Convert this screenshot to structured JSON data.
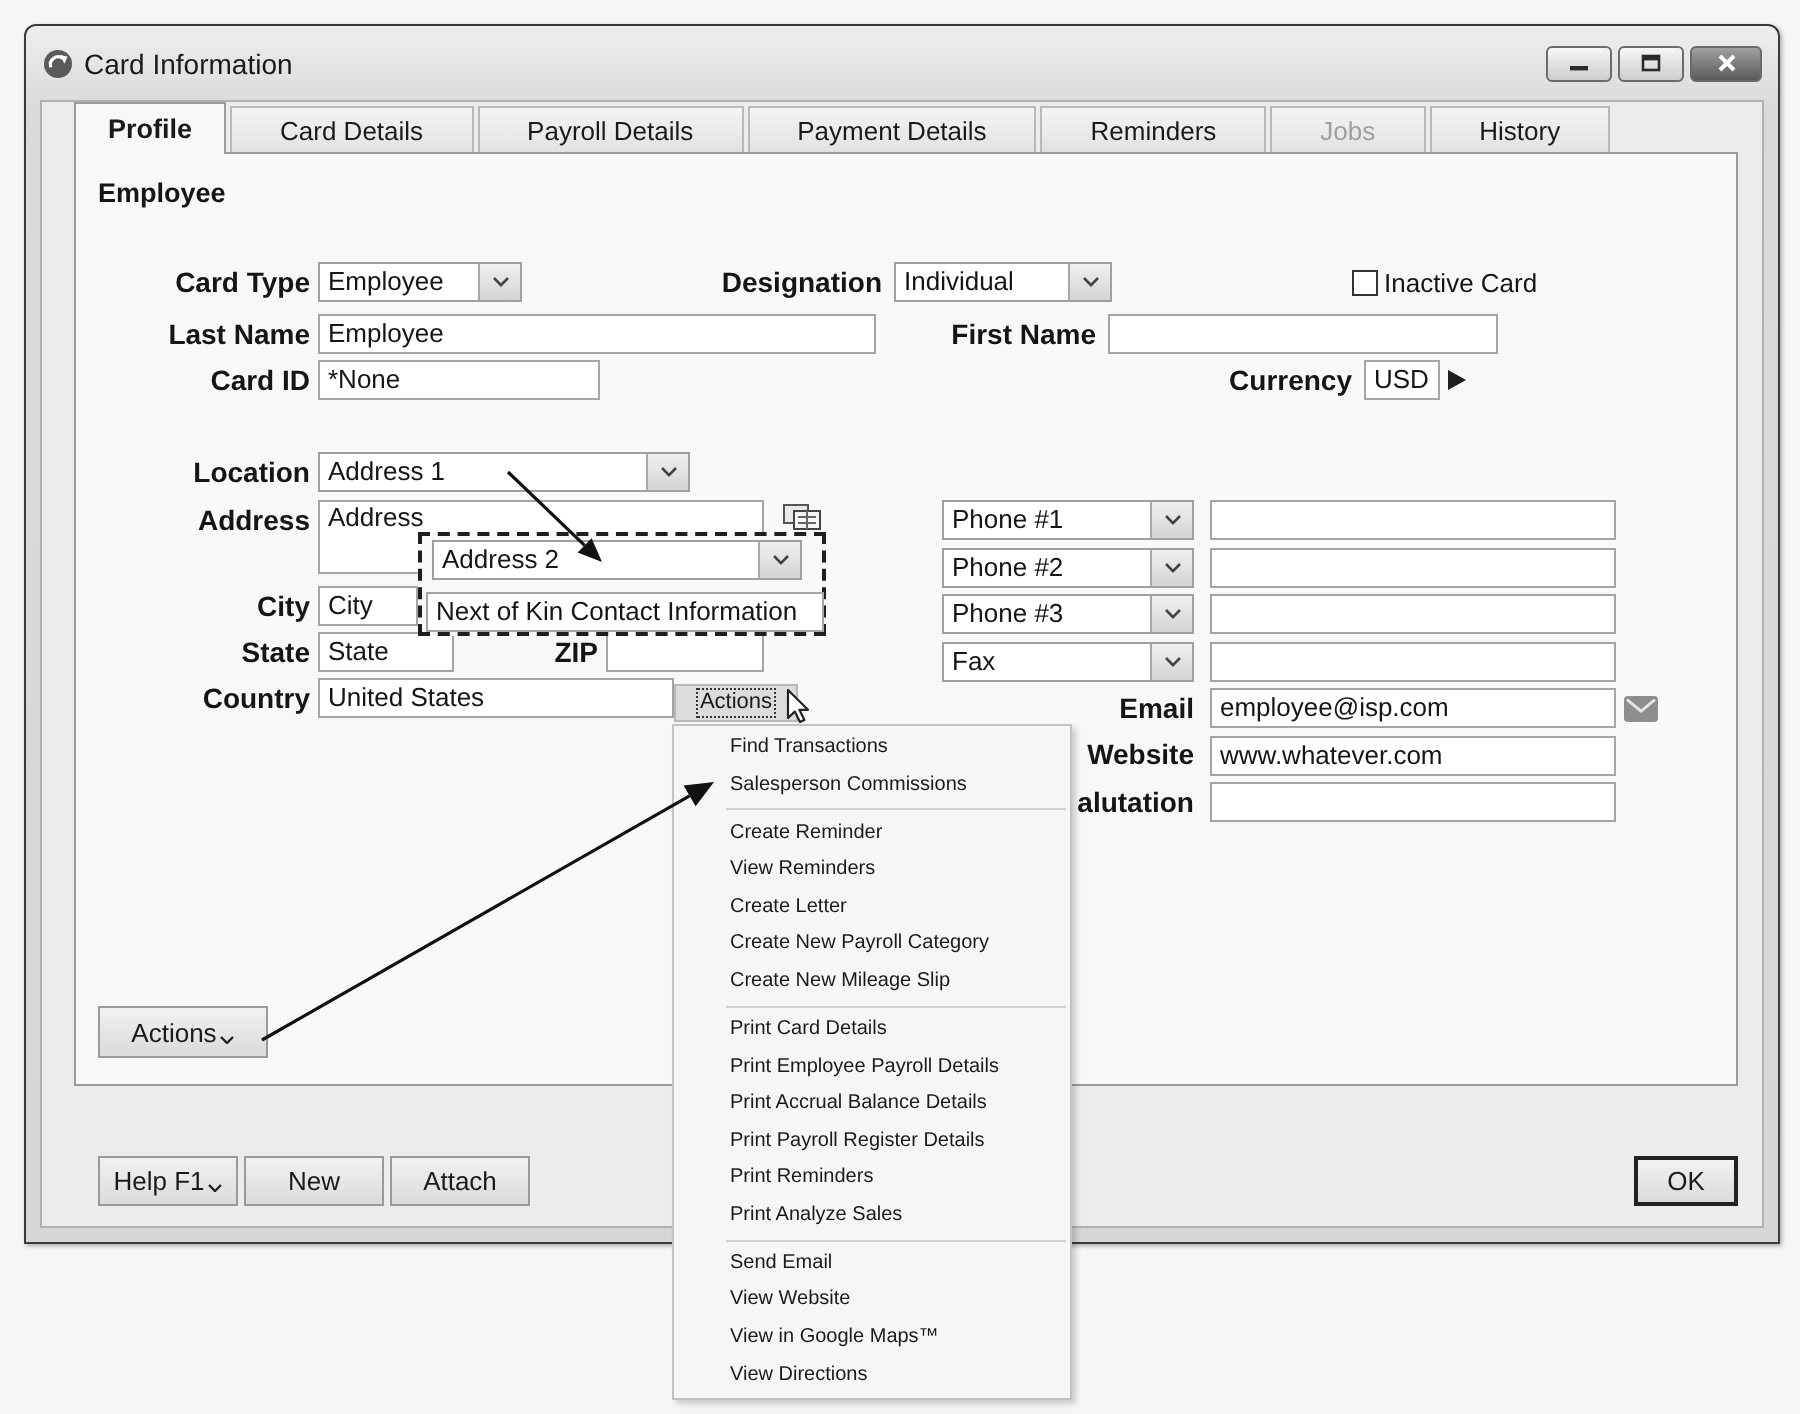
{
  "window": {
    "title": "Card Information"
  },
  "tabs": [
    {
      "label": "Profile",
      "selected": true,
      "disabled": false
    },
    {
      "label": "Card Details",
      "selected": false,
      "disabled": false
    },
    {
      "label": "Payroll Details",
      "selected": false,
      "disabled": false
    },
    {
      "label": "Payment Details",
      "selected": false,
      "disabled": false
    },
    {
      "label": "Reminders",
      "selected": false,
      "disabled": false
    },
    {
      "label": "Jobs",
      "selected": false,
      "disabled": true
    },
    {
      "label": "History",
      "selected": false,
      "disabled": false
    }
  ],
  "section_title": "Employee",
  "card_type": {
    "label": "Card Type",
    "value": "Employee"
  },
  "designation": {
    "label": "Designation",
    "value": "Individual"
  },
  "inactive_card": {
    "label": "Inactive Card",
    "checked": false
  },
  "last_name": {
    "label": "Last Name",
    "value": "Employee"
  },
  "first_name": {
    "label": "First Name"
  },
  "card_id": {
    "label": "Card ID",
    "value": "*None"
  },
  "currency": {
    "label": "Currency",
    "value": "USD"
  },
  "location": {
    "label": "Location",
    "value": "Address 1"
  },
  "address": {
    "label": "Address",
    "value": "Address"
  },
  "city": {
    "label": "City",
    "value": "City"
  },
  "state": {
    "label": "State",
    "value": "State"
  },
  "zip": {
    "label": "ZIP"
  },
  "country": {
    "label": "Country",
    "value": "United States"
  },
  "phones": [
    {
      "type": "Phone #1"
    },
    {
      "type": "Phone #2"
    },
    {
      "type": "Phone #3"
    },
    {
      "type": "Fax"
    }
  ],
  "email": {
    "label": "Email",
    "value": "employee@isp.com"
  },
  "website": {
    "label": "Website",
    "value": "www.whatever.com"
  },
  "salutation": {
    "label": "alutation"
  },
  "actions_button": "Actions",
  "footer_buttons": [
    {
      "label": "Help F1",
      "kind": "dropdown"
    },
    {
      "label": "New",
      "kind": "plain"
    },
    {
      "label": "Attach",
      "kind": "plain"
    }
  ],
  "ok_button": "OK",
  "callout": {
    "location": "Address 2",
    "location_name": "Next of Kin Contact Information"
  },
  "actions_menu": {
    "button": "Actions",
    "groups": [
      {
        "items": [
          "Find Transactions",
          "Salesperson Commissions"
        ]
      },
      {
        "items": [
          "Create Reminder",
          "View Reminders",
          "Create Letter",
          "Create New Payroll Category",
          "Create New Mileage Slip"
        ]
      },
      {
        "items": [
          "Print Card Details",
          "Print Employee Payroll Details",
          "Print Accrual Balance Details",
          "Print Payroll Register Details",
          "Print Reminders",
          "Print Analyze Sales"
        ]
      },
      {
        "items": [
          "Send Email",
          "View Website",
          "View in Google Maps™",
          "View Directions"
        ]
      }
    ]
  }
}
